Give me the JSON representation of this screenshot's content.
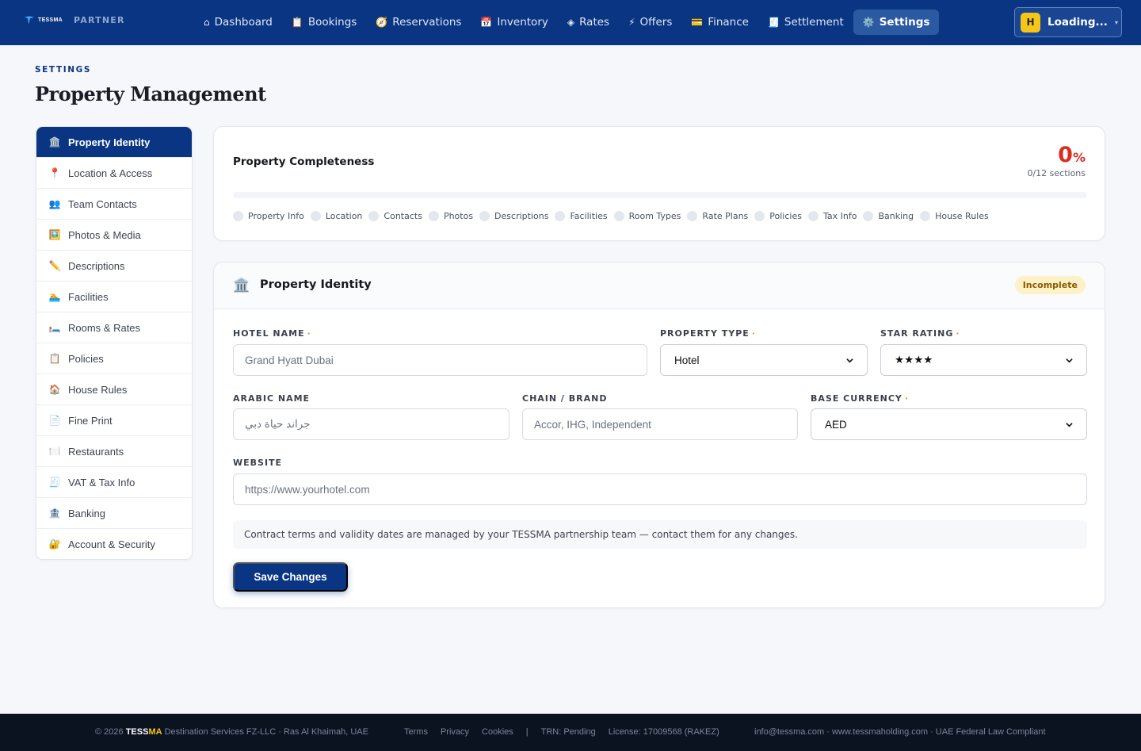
{
  "brand": {
    "name": "TESSMA",
    "partner_label": "PARTNER"
  },
  "nav": [
    {
      "label": "Dashboard",
      "icon": "⌂"
    },
    {
      "label": "Bookings",
      "icon": "📋"
    },
    {
      "label": "Reservations",
      "icon": "🧭"
    },
    {
      "label": "Inventory",
      "icon": "📅"
    },
    {
      "label": "Rates",
      "icon": "◈"
    },
    {
      "label": "Offers",
      "icon": "⚡"
    },
    {
      "label": "Finance",
      "icon": "💳"
    },
    {
      "label": "Settlement",
      "icon": "🧾"
    },
    {
      "label": "Settings",
      "icon": "⚙️",
      "active": true
    }
  ],
  "user": {
    "avatar": "H",
    "name": "Loading...",
    "caret": "▾"
  },
  "page": {
    "eyebrow": "SETTINGS",
    "title": "Property Management"
  },
  "sidebar": [
    {
      "label": "Property Identity",
      "icon": "🏛️",
      "active": true
    },
    {
      "label": "Location & Access",
      "icon": "📍"
    },
    {
      "label": "Team Contacts",
      "icon": "👥"
    },
    {
      "label": "Photos & Media",
      "icon": "🖼️"
    },
    {
      "label": "Descriptions",
      "icon": "✏️"
    },
    {
      "label": "Facilities",
      "icon": "🏊"
    },
    {
      "label": "Rooms & Rates",
      "icon": "🛏️"
    },
    {
      "label": "Policies",
      "icon": "📋"
    },
    {
      "label": "House Rules",
      "icon": "🏠"
    },
    {
      "label": "Fine Print",
      "icon": "📄"
    },
    {
      "label": "Restaurants",
      "icon": "🍽️"
    },
    {
      "label": "VAT & Tax Info",
      "icon": "🧾"
    },
    {
      "label": "Banking",
      "icon": "🏦"
    },
    {
      "label": "Account & Security",
      "icon": "🔐"
    }
  ],
  "completeness": {
    "title": "Property Completeness",
    "percent_value": "0",
    "percent_symbol": "%",
    "progress_fraction": 0,
    "sections_text": "0/12 sections",
    "sections": [
      "Property Info",
      "Location",
      "Contacts",
      "Photos",
      "Descriptions",
      "Facilities",
      "Room Types",
      "Rate Plans",
      "Policies",
      "Tax Info",
      "Banking",
      "House Rules"
    ]
  },
  "identity": {
    "icon": "🏛️",
    "title": "Property Identity",
    "status": "Incomplete",
    "fields": {
      "hotel_name": {
        "label": "HOTEL NAME",
        "placeholder": "Grand Hyatt Dubai",
        "required": true
      },
      "property_type": {
        "label": "PROPERTY TYPE",
        "value": "Hotel",
        "required": true
      },
      "star_rating": {
        "label": "STAR RATING",
        "value": "★★★★",
        "required": true
      },
      "arabic_name": {
        "label": "ARABIC NAME",
        "placeholder": "جراند حياة دبي"
      },
      "chain_brand": {
        "label": "CHAIN / BRAND",
        "placeholder": "Accor, IHG, Independent"
      },
      "base_currency": {
        "label": "BASE CURRENCY",
        "value": "AED",
        "required": true
      },
      "website": {
        "label": "WEBSITE",
        "placeholder": "https://www.yourhotel.com"
      }
    },
    "required_marker": "·",
    "note": "Contract terms and validity dates are managed by your TESSMA partnership team — contact them for any changes.",
    "save_label": "Save Changes"
  },
  "footer": {
    "copy_prefix": "© 2026 ",
    "copy_tess": "TESS",
    "copy_ma": "MA",
    "copy_suffix": " Destination Services FZ-LLC · Ras Al Khaimah, UAE",
    "links": [
      "Terms",
      "Privacy",
      "Cookies"
    ],
    "separator": "|",
    "trn": "TRN: Pending",
    "license": "License: 17009568 (RAKEZ)",
    "contact": "info@tessma.com · www.tessmaholding.com · UAE Federal Law Compliant"
  },
  "colors": {
    "primary": "#0a3583",
    "accent": "#f5c518",
    "danger": "#d92d20",
    "badge_bg": "#fdf1c8"
  }
}
